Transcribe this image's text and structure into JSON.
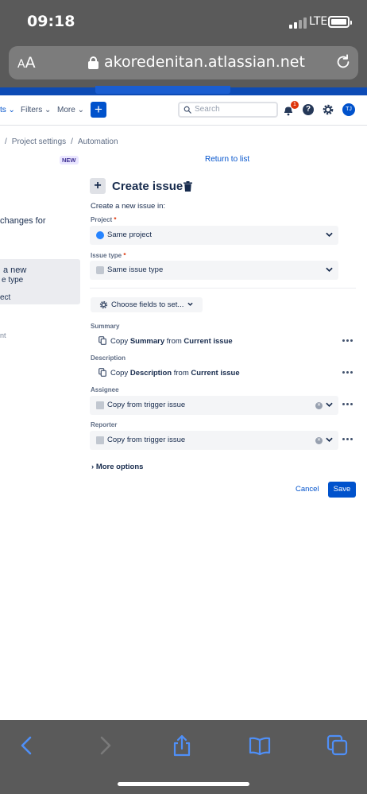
{
  "status_bar": {
    "time": "09:18",
    "network": "LTE"
  },
  "browser": {
    "text_size_label": "AA",
    "url": "akoredenitan.atlassian.net",
    "icons": [
      "lock-icon",
      "reload-icon",
      "back-icon",
      "forward-icon",
      "share-icon",
      "bookmarks-icon",
      "tabs-icon"
    ]
  },
  "topnav": {
    "projects_partial": "ts",
    "filters": "Filters",
    "more": "More",
    "create": "+",
    "search_placeholder": "Search",
    "notifications_count": "1",
    "help": "?",
    "avatar_initials": "TJ"
  },
  "breadcrumb": {
    "items": [
      "Project settings",
      "Automation"
    ]
  },
  "sidebar": {
    "new_badge": "NEW",
    "text1": "changes for",
    "selected_line1": "a new",
    "selected_line2": "e type",
    "selected_line3": "ect",
    "text2": "nt"
  },
  "return_link": "Return to list",
  "panel": {
    "icon": "+",
    "title": "Create issue",
    "subtitle": "Create a new issue in:",
    "project_label": "Project",
    "project_value": "Same project",
    "issue_type_label": "Issue type",
    "issue_type_value": "Same issue type",
    "choose_fields": "Choose fields to set...",
    "required_mark": "*"
  },
  "fields": [
    {
      "label": "Summary",
      "prefix": "Copy",
      "field": "Summary",
      "middle": "from",
      "source": "Current issue"
    },
    {
      "label": "Description",
      "prefix": "Copy",
      "field": "Description",
      "middle": "from",
      "source": "Current issue"
    }
  ],
  "user_fields": [
    {
      "label": "Assignee",
      "value": "Copy from trigger issue"
    },
    {
      "label": "Reporter",
      "value": "Copy from trigger issue"
    }
  ],
  "more_options": "More options",
  "actions": {
    "cancel": "Cancel",
    "save": "Save"
  },
  "colors": {
    "primary": "#0052cc",
    "brand_strip": "#0d4bb5",
    "safari_chrome": "#5a5a5a",
    "field_bg": "#f4f5f7",
    "badge_red": "#de350b"
  }
}
